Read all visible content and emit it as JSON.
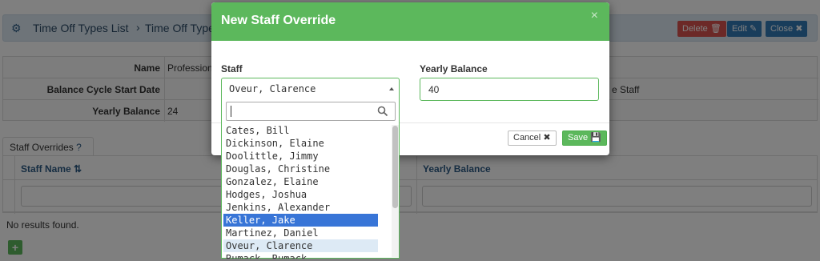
{
  "page": {
    "breadcrumb": [
      "Time Off Types List",
      "Time Off Type"
    ],
    "buttons": {
      "delete": "Delete",
      "edit": "Edit",
      "close": "Close"
    },
    "details": [
      {
        "label": "Name",
        "value": "Profession",
        "extra": ""
      },
      {
        "label": "Balance Cycle Start Date",
        "value": "",
        "extra": "e Staff"
      },
      {
        "label": "Yearly Balance",
        "value": "24",
        "extra": ""
      }
    ],
    "tab_label": "Staff Overrides",
    "columns": [
      "Staff Name",
      "Yearly Balance"
    ],
    "no_results": "No results found.",
    "add_label": "+"
  },
  "modal": {
    "title": "New Staff Override",
    "close_glyph": "×",
    "staff_label": "Staff",
    "staff_value": "Oveur, Clarence",
    "balance_label": "Yearly Balance",
    "balance_value": "40",
    "cancel_label": "Cancel",
    "save_label": "Save"
  },
  "dropdown": {
    "search_value": "",
    "highlighted": "Keller, Jake",
    "selected": "Oveur, Clarence",
    "options": [
      "Cates, Bill",
      "Dickinson, Elaine",
      "Doolittle, Jimmy",
      "Douglas, Christine",
      "Gonzalez, Elaine",
      "Hodges, Joshua",
      "Jenkins, Alexander",
      "Keller, Jake",
      "Martinez, Daniel",
      "Oveur, Clarence",
      "Rumack, Rumack"
    ]
  },
  "colors": {
    "modal_header": "#5cb85c",
    "highlight": "#3875d7",
    "danger": "#d9534f",
    "primary": "#337ab7",
    "link_text": "#2c5a85"
  },
  "icons": [
    "gear-icon",
    "trash-icon",
    "pencil-icon",
    "close-icon",
    "question-circle-icon",
    "sort-icon",
    "search-icon",
    "cross-icon",
    "save-icon",
    "plus-icon"
  ]
}
